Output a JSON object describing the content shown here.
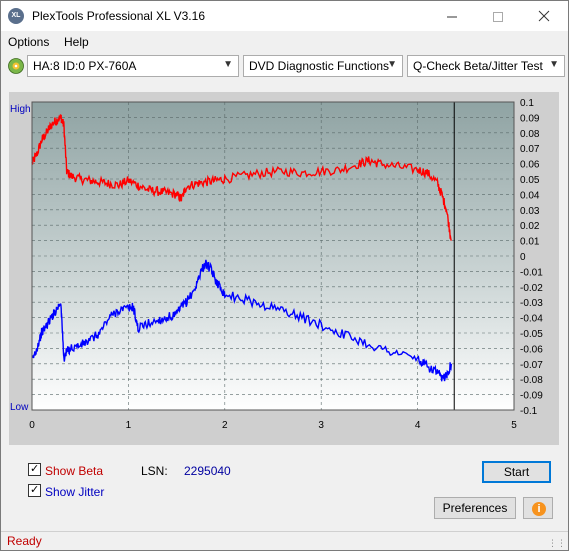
{
  "window": {
    "title": "PlexTools Professional XL V3.16",
    "icon_text": "XL",
    "minimize_icon": "minimize-icon",
    "maximize_icon": "maximize-icon",
    "close_icon": "close-icon"
  },
  "menu": {
    "options": "Options",
    "help": "Help"
  },
  "toolbar": {
    "drive": "HA:8 ID:0  PX-760A",
    "function": "DVD Diagnostic Functions",
    "test": "Q-Check Beta/Jitter Test"
  },
  "chart_data": {
    "type": "line",
    "left_axis": {
      "high_label": "High",
      "low_label": "Low"
    },
    "x_ticks": [
      "0",
      "1",
      "2",
      "3",
      "4",
      "5"
    ],
    "xlim": [
      0,
      5
    ],
    "y_ticks_right": [
      "0.1",
      "0.09",
      "0.08",
      "0.07",
      "0.06",
      "0.05",
      "0.04",
      "0.03",
      "0.02",
      "0.01",
      "0",
      "-0.01",
      "-0.02",
      "-0.03",
      "-0.04",
      "-0.05",
      "-0.06",
      "-0.07",
      "-0.08",
      "-0.09",
      "-0.1"
    ],
    "ylim": [
      -0.1,
      0.1
    ],
    "cursor_x": 4.38,
    "grid": true,
    "series": [
      {
        "color": "#ff0000",
        "x": [
          0.0,
          0.05,
          0.1,
          0.15,
          0.2,
          0.25,
          0.3,
          0.33,
          0.36,
          0.4,
          0.5,
          0.6,
          0.7,
          0.8,
          0.9,
          1.0,
          1.1,
          1.2,
          1.3,
          1.4,
          1.5,
          1.55,
          1.6,
          1.7,
          1.8,
          1.9,
          2.0,
          2.2,
          2.4,
          2.6,
          2.8,
          3.0,
          3.2,
          3.4,
          3.5,
          3.6,
          3.8,
          4.0,
          4.1,
          4.2,
          4.25,
          4.3,
          4.35
        ],
        "values": [
          0.06,
          0.066,
          0.075,
          0.08,
          0.085,
          0.088,
          0.09,
          0.085,
          0.055,
          0.052,
          0.05,
          0.049,
          0.048,
          0.047,
          0.046,
          0.049,
          0.046,
          0.043,
          0.042,
          0.041,
          0.04,
          0.037,
          0.045,
          0.047,
          0.048,
          0.049,
          0.05,
          0.052,
          0.054,
          0.055,
          0.054,
          0.055,
          0.056,
          0.06,
          0.062,
          0.06,
          0.058,
          0.056,
          0.054,
          0.048,
          0.04,
          0.03,
          0.01
        ]
      },
      {
        "color": "#0000ff",
        "x": [
          0.0,
          0.05,
          0.1,
          0.15,
          0.2,
          0.25,
          0.3,
          0.33,
          0.36,
          0.4,
          0.5,
          0.6,
          0.7,
          0.8,
          0.9,
          1.0,
          1.05,
          1.1,
          1.2,
          1.3,
          1.4,
          1.5,
          1.55,
          1.6,
          1.7,
          1.75,
          1.8,
          1.85,
          1.9,
          1.95,
          2.0,
          2.2,
          2.4,
          2.6,
          2.8,
          3.0,
          3.2,
          3.4,
          3.6,
          3.8,
          4.0,
          4.1,
          4.2,
          4.25,
          4.3,
          4.35
        ],
        "values": [
          -0.068,
          -0.06,
          -0.05,
          -0.045,
          -0.04,
          -0.035,
          -0.03,
          -0.067,
          -0.062,
          -0.06,
          -0.058,
          -0.055,
          -0.05,
          -0.04,
          -0.035,
          -0.034,
          -0.033,
          -0.047,
          -0.044,
          -0.042,
          -0.04,
          -0.038,
          -0.033,
          -0.03,
          -0.02,
          -0.01,
          -0.005,
          -0.008,
          -0.015,
          -0.02,
          -0.025,
          -0.028,
          -0.032,
          -0.035,
          -0.04,
          -0.045,
          -0.05,
          -0.055,
          -0.06,
          -0.063,
          -0.067,
          -0.072,
          -0.075,
          -0.08,
          -0.077,
          -0.07
        ]
      }
    ]
  },
  "controls": {
    "show_beta_label": "Show Beta",
    "show_jitter_label": "Show Jitter",
    "show_beta_checked": true,
    "show_jitter_checked": true,
    "lsn_label": "LSN:",
    "lsn_value": "2295040",
    "start_label": "Start",
    "preferences_label": "Preferences",
    "info_icon": "info-icon",
    "beta_color": "#c00000",
    "jitter_color": "#0000c0",
    "lsn_value_color": "#0000a0"
  },
  "status": {
    "text": "Ready"
  }
}
